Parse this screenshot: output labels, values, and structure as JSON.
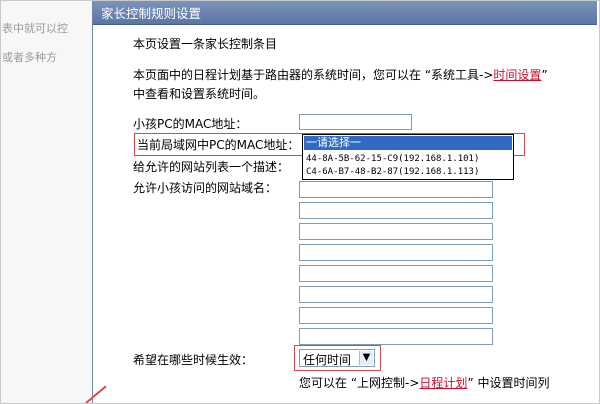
{
  "background": {
    "line1": "表中就可以控",
    "line2": "或者多种方"
  },
  "dialog": {
    "title": "家长控制规则设置",
    "heading": "本页设置一条家长控制条目",
    "desc_part1": "本页面中的日程计划基于路由器的系统时间，您可以在 “系统工具->",
    "desc_link": "时间设置",
    "desc_part2": "”",
    "desc_line2": "中查看和设置系统时间。",
    "child_mac_label": "小孩PC的MAC地址：",
    "child_mac_value": "",
    "current_mac_label": "当前局域网中PC的MAC地址：",
    "dropdown_options": [
      "一请选择一",
      "44-8A-5B-62-15-C9(192.168.1.101)",
      "C4-6A-B7-48-B2-87(192.168.1.113)"
    ],
    "allowed_list_desc_label": "给允许的网站列表一个描述：",
    "allowed_domains_label": "允许小孩访问的网站域名：",
    "domain_values": [
      "",
      "",
      "",
      "",
      "",
      "",
      "",
      ""
    ],
    "effective_time_label": "希望在哪些时候生效：",
    "time_select_value": "任何时间",
    "time_note_part1": "您可以在 “上网控制->",
    "time_note_link": "日程计划",
    "time_note_part2": "” 中设置时间列"
  },
  "colors": {
    "title_bar": "#5b76a3",
    "highlight_red": "#d9484b",
    "link_red": "#c8102e",
    "selection_blue": "#316ac5"
  }
}
